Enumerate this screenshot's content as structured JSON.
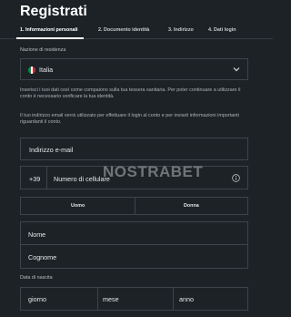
{
  "page_title": "Registrati",
  "steps": [
    {
      "label": "1. Informazioni personali"
    },
    {
      "label": "2. Documento identità"
    },
    {
      "label": "3. Indirizzo"
    },
    {
      "label": "4. Dati login"
    }
  ],
  "nationality": {
    "label": "Nazione di residenza",
    "value": "Italia",
    "flag_colors": [
      "#009246",
      "#ffffff",
      "#ce2b37"
    ]
  },
  "info_text_1": "Inserisci i tuoi dati così come compaiono sulla tua tessera sanitaria. Per poter continuare a utilizzare il conto è necessario verificare la tua identità.",
  "info_text_2": "Il tuo indirizzo email verrà utilizzato per effettuare il login al conto e per inviarti informazioni importanti riguardanti il conto.",
  "email": {
    "placeholder": "Indirizzo e-mail"
  },
  "phone": {
    "prefix": "+39",
    "placeholder": "Numero di cellulare"
  },
  "gender": {
    "male": "Uomo",
    "female": "Donna"
  },
  "first_name": {
    "placeholder": "Nome"
  },
  "last_name": {
    "placeholder": "Cognome"
  },
  "dob": {
    "label": "Data di nascita",
    "day": "giorno",
    "month": "mese",
    "year": "anno"
  },
  "watermark": "NOSTRABET",
  "colors": {
    "background": "#1d2226",
    "border": "#3d444b",
    "text": "#e6e9ec"
  }
}
